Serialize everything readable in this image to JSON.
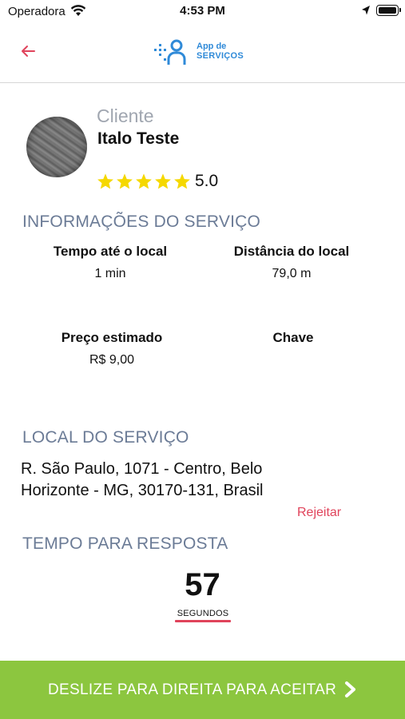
{
  "status_bar": {
    "carrier": "Operadora",
    "time": "4:53 PM"
  },
  "nav": {
    "back_icon": "arrow-left-icon",
    "logo_line1": "App de",
    "logo_line2": "SERVIÇOS"
  },
  "client": {
    "label": "Cliente",
    "name": "Italo Teste",
    "stars": 5,
    "rating": "5.0"
  },
  "service_info": {
    "heading": "INFORMAÇÕES DO SERVIÇO",
    "time_label": "Tempo até o local",
    "time_value": "1 min",
    "distance_label": "Distância do local",
    "distance_value": "79,0 m",
    "price_label": "Preço estimado",
    "price_value": "R$ 9,00",
    "key_label": "Chave",
    "key_value": ""
  },
  "location": {
    "heading": "LOCAL DO SERVIÇO",
    "address": "R. São Paulo, 1071 - Centro, Belo Horizonte - MG, 30170-131, Brasil",
    "reject_label": "Rejeitar"
  },
  "response_time": {
    "heading": "TEMPO PARA RESPOSTA",
    "seconds": "57",
    "unit": "SEGUNDOS"
  },
  "slider": {
    "label": "DESLIZE PARA DIREITA PARA ACEITAR",
    "icon": "chevron-right-icon"
  },
  "colors": {
    "accent_red": "#e0435b",
    "accept_green": "#8cc63f",
    "heading_blue_gray": "#6b7b96",
    "star_yellow": "#f5d800",
    "logo_blue": "#2f8ad8"
  }
}
